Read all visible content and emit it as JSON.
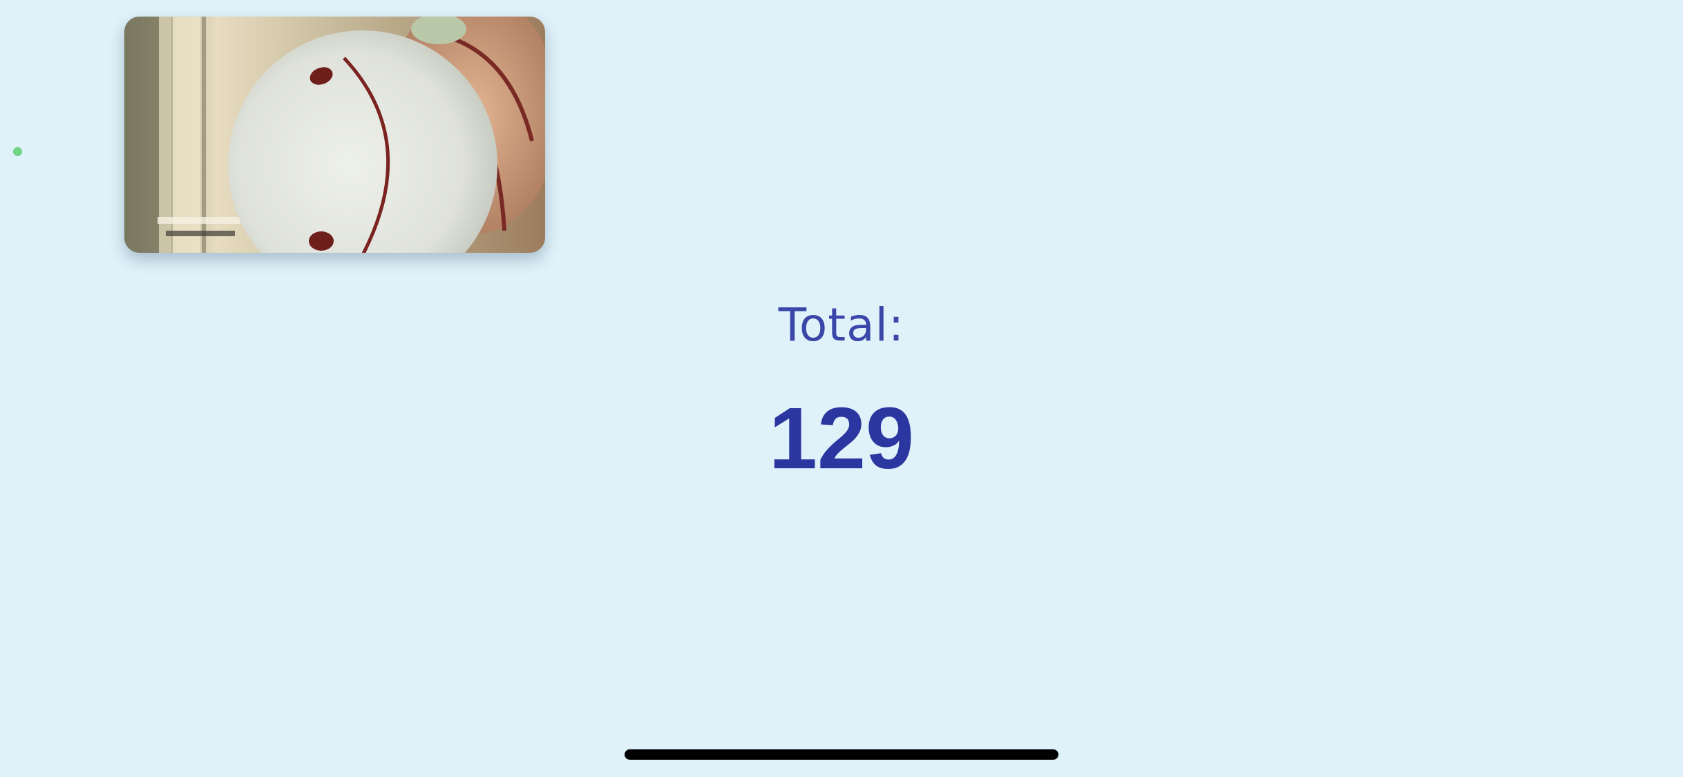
{
  "counter": {
    "label": "Total:",
    "value": "129"
  },
  "icons": {
    "status_dot": "mic-in-use-indicator-icon",
    "home_bar": "home-indicator-icon"
  },
  "colors": {
    "background": "#dff1f9",
    "label_text": "#3a46a8",
    "value_text": "#2b36a0",
    "status_dot": "#6fd486",
    "home_indicator": "#000000"
  }
}
